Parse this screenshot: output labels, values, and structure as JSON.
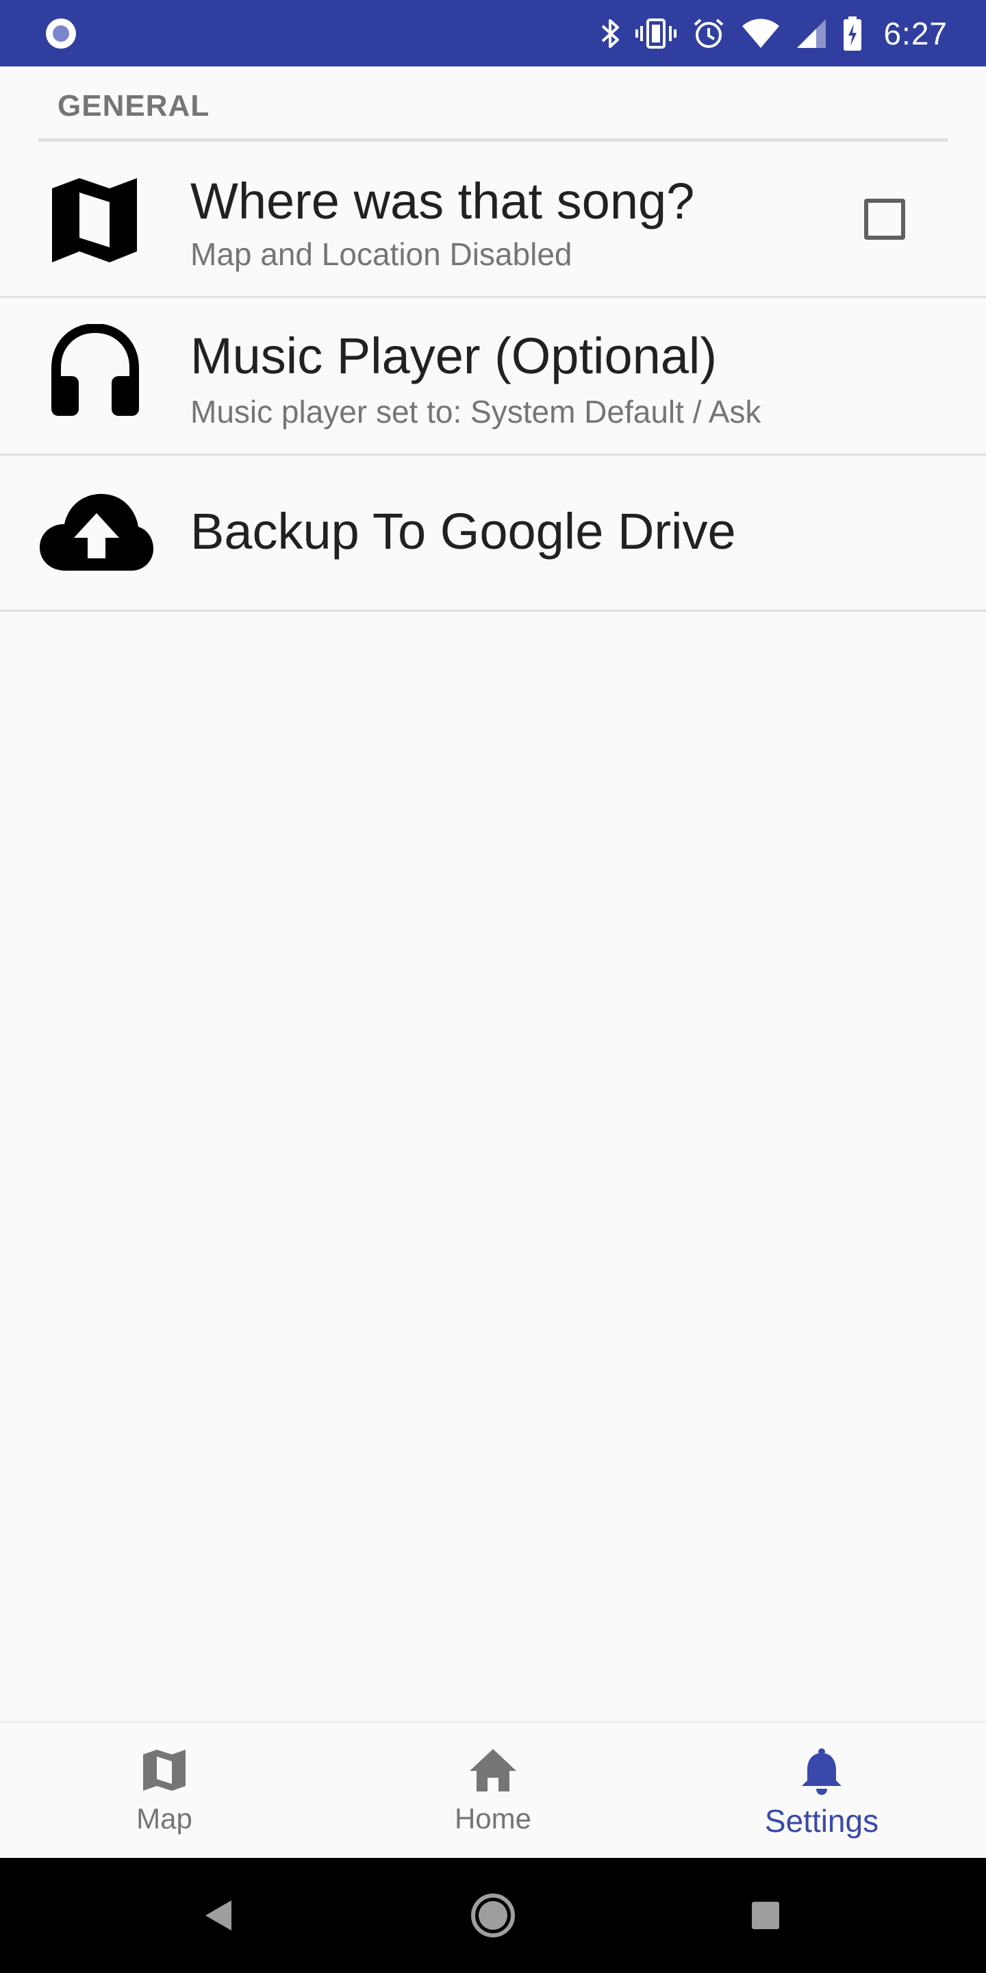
{
  "status_bar": {
    "time": "6:27",
    "icons": [
      "radio-button-icon",
      "bluetooth-icon",
      "vibrate-icon",
      "alarm-icon",
      "wifi-icon",
      "signal-icon",
      "battery-charging-icon"
    ],
    "background": "#303f9f"
  },
  "section": {
    "header": "GENERAL"
  },
  "settings": {
    "items": [
      {
        "icon": "map-icon",
        "title": "Where was that song?",
        "subtitle": "Map and Location Disabled",
        "checked": false
      },
      {
        "icon": "headphones-icon",
        "title": "Music Player (Optional)",
        "subtitle": "Music player set to: System Default / Ask"
      },
      {
        "icon": "cloud-upload-icon",
        "title": "Backup To Google Drive"
      }
    ]
  },
  "bottom_nav": {
    "items": [
      {
        "icon": "map-icon",
        "label": "Map",
        "active": false
      },
      {
        "icon": "home-icon",
        "label": "Home",
        "active": false
      },
      {
        "icon": "bell-icon",
        "label": "Settings",
        "active": true
      }
    ],
    "active_color": "#3949ab",
    "inactive_color": "#757575"
  },
  "system_nav": {
    "buttons": [
      "back-icon",
      "home-circle-icon",
      "recents-icon"
    ]
  }
}
